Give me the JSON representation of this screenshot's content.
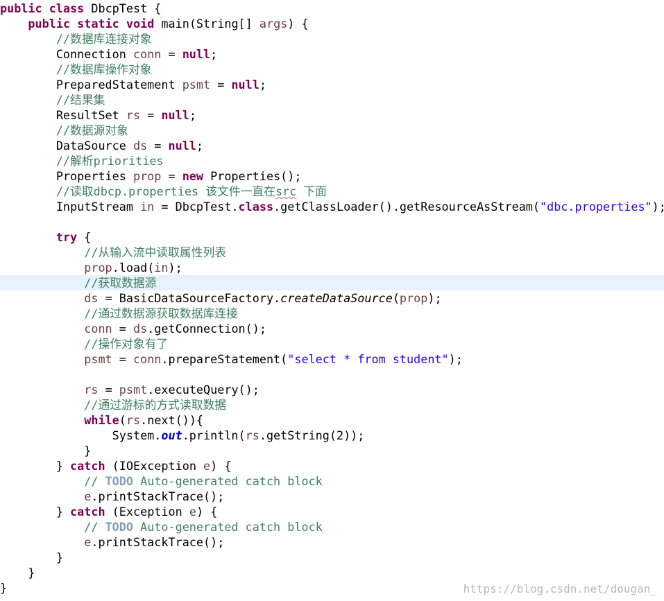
{
  "editor": {
    "highlighted_line": 18,
    "lines": [
      [
        {
          "t": "public",
          "c": "kw"
        },
        {
          "t": " "
        },
        {
          "t": "class",
          "c": "kw"
        },
        {
          "t": " DbcpTest {"
        }
      ],
      [
        {
          "t": "    "
        },
        {
          "t": "public",
          "c": "kw"
        },
        {
          "t": " "
        },
        {
          "t": "static",
          "c": "kw"
        },
        {
          "t": " "
        },
        {
          "t": "void",
          "c": "kw"
        },
        {
          "t": " main(String[] "
        },
        {
          "t": "args",
          "c": "var"
        },
        {
          "t": ") {"
        }
      ],
      [
        {
          "t": "        "
        },
        {
          "t": "//数据库连接对象",
          "c": "cm"
        }
      ],
      [
        {
          "t": "        Connection "
        },
        {
          "t": "conn",
          "c": "var"
        },
        {
          "t": " = "
        },
        {
          "t": "null",
          "c": "kw"
        },
        {
          "t": ";"
        }
      ],
      [
        {
          "t": "        "
        },
        {
          "t": "//数据库操作对象",
          "c": "cm"
        }
      ],
      [
        {
          "t": "        PreparedStatement "
        },
        {
          "t": "psmt",
          "c": "var"
        },
        {
          "t": " = "
        },
        {
          "t": "null",
          "c": "kw"
        },
        {
          "t": ";"
        }
      ],
      [
        {
          "t": "        "
        },
        {
          "t": "//结果集",
          "c": "cm"
        }
      ],
      [
        {
          "t": "        ResultSet "
        },
        {
          "t": "rs",
          "c": "var"
        },
        {
          "t": " = "
        },
        {
          "t": "null",
          "c": "kw"
        },
        {
          "t": ";"
        }
      ],
      [
        {
          "t": "        "
        },
        {
          "t": "//数据源对象",
          "c": "cm"
        }
      ],
      [
        {
          "t": "        DataSource "
        },
        {
          "t": "ds",
          "c": "var"
        },
        {
          "t": " = "
        },
        {
          "t": "null",
          "c": "kw"
        },
        {
          "t": ";"
        }
      ],
      [
        {
          "t": "        "
        },
        {
          "t": "//解析priorities",
          "c": "cm"
        }
      ],
      [
        {
          "t": "        Properties "
        },
        {
          "t": "prop",
          "c": "var"
        },
        {
          "t": " = "
        },
        {
          "t": "new",
          "c": "kw"
        },
        {
          "t": " Properties();"
        }
      ],
      [
        {
          "t": "        "
        },
        {
          "t": "//读取dbcp.properties 该文件一直在",
          "c": "cm"
        },
        {
          "t": "src",
          "c": "cm squiggle"
        },
        {
          "t": " 下面",
          "c": "cm"
        }
      ],
      [
        {
          "t": "        InputStream "
        },
        {
          "t": "in",
          "c": "var"
        },
        {
          "t": " = DbcpTest."
        },
        {
          "t": "class",
          "c": "kw"
        },
        {
          "t": ".getClassLoader().getResourceAsStream("
        },
        {
          "t": "\"dbc.properties\"",
          "c": "st"
        },
        {
          "t": ");"
        }
      ],
      [],
      [
        {
          "t": "        "
        },
        {
          "t": "try",
          "c": "kw"
        },
        {
          "t": " {"
        }
      ],
      [
        {
          "t": "            "
        },
        {
          "t": "//从输入流中读取属性列表",
          "c": "cm"
        }
      ],
      [
        {
          "t": "            "
        },
        {
          "t": "prop",
          "c": "var"
        },
        {
          "t": ".load("
        },
        {
          "t": "in",
          "c": "var"
        },
        {
          "t": ");"
        }
      ],
      [
        {
          "t": "            "
        },
        {
          "t": "//获取数据源",
          "c": "cm"
        }
      ],
      [
        {
          "t": "            "
        },
        {
          "t": "ds",
          "c": "var"
        },
        {
          "t": " = BasicDataSourceFactory."
        },
        {
          "t": "createDataSource",
          "c": "smethod"
        },
        {
          "t": "("
        },
        {
          "t": "prop",
          "c": "var"
        },
        {
          "t": ");"
        }
      ],
      [
        {
          "t": "            "
        },
        {
          "t": "//通过数据源获取数据库连接",
          "c": "cm"
        }
      ],
      [
        {
          "t": "            "
        },
        {
          "t": "conn",
          "c": "var"
        },
        {
          "t": " = "
        },
        {
          "t": "ds",
          "c": "var"
        },
        {
          "t": ".getConnection();"
        }
      ],
      [
        {
          "t": "            "
        },
        {
          "t": "//操作对象有了",
          "c": "cm"
        }
      ],
      [
        {
          "t": "            "
        },
        {
          "t": "psmt",
          "c": "var"
        },
        {
          "t": " = "
        },
        {
          "t": "conn",
          "c": "var"
        },
        {
          "t": ".prepareStatement("
        },
        {
          "t": "\"select * from student\"",
          "c": "st"
        },
        {
          "t": ");"
        }
      ],
      [],
      [
        {
          "t": "            "
        },
        {
          "t": "rs",
          "c": "var"
        },
        {
          "t": " = "
        },
        {
          "t": "psmt",
          "c": "var"
        },
        {
          "t": ".executeQuery();"
        }
      ],
      [
        {
          "t": "            "
        },
        {
          "t": "//通过游标的方式读取数据",
          "c": "cm"
        }
      ],
      [
        {
          "t": "            "
        },
        {
          "t": "while",
          "c": "kw"
        },
        {
          "t": "("
        },
        {
          "t": "rs",
          "c": "var"
        },
        {
          "t": ".next()){"
        }
      ],
      [
        {
          "t": "                System."
        },
        {
          "t": "out",
          "c": "field"
        },
        {
          "t": ".println("
        },
        {
          "t": "rs",
          "c": "var"
        },
        {
          "t": ".getString(2));"
        }
      ],
      [
        {
          "t": "            }"
        }
      ],
      [
        {
          "t": "        } "
        },
        {
          "t": "catch",
          "c": "kw"
        },
        {
          "t": " (IOException "
        },
        {
          "t": "e",
          "c": "var"
        },
        {
          "t": ") {"
        }
      ],
      [
        {
          "t": "            "
        },
        {
          "t": "// ",
          "c": "cm"
        },
        {
          "t": "TODO",
          "c": "todo"
        },
        {
          "t": " Auto-generated catch block",
          "c": "cm"
        }
      ],
      [
        {
          "t": "            "
        },
        {
          "t": "e",
          "c": "var"
        },
        {
          "t": ".printStackTrace();"
        }
      ],
      [
        {
          "t": "        } "
        },
        {
          "t": "catch",
          "c": "kw"
        },
        {
          "t": " (Exception "
        },
        {
          "t": "e",
          "c": "var"
        },
        {
          "t": ") {"
        }
      ],
      [
        {
          "t": "            "
        },
        {
          "t": "// ",
          "c": "cm"
        },
        {
          "t": "TODO",
          "c": "todo"
        },
        {
          "t": " Auto-generated catch block",
          "c": "cm"
        }
      ],
      [
        {
          "t": "            "
        },
        {
          "t": "e",
          "c": "var"
        },
        {
          "t": ".printStackTrace();"
        }
      ],
      [
        {
          "t": "        }"
        }
      ],
      [
        {
          "t": "    }"
        }
      ],
      [
        {
          "t": "}"
        }
      ]
    ]
  },
  "watermark": "https://blog.csdn.net/dougan_"
}
